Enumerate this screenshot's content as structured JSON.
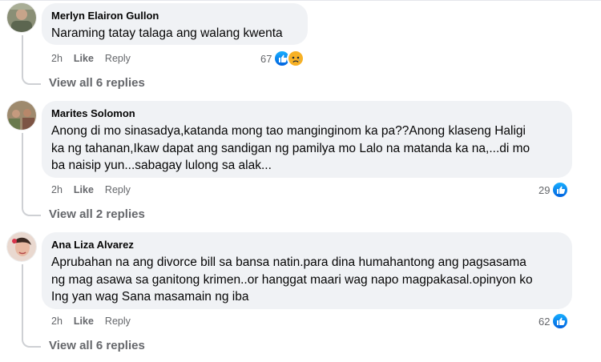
{
  "comments": [
    {
      "author": "Merlyn Elairon Gullon",
      "text": "Naraming tatay talaga ang walang kwenta",
      "time": "2h",
      "like_label": "Like",
      "reply_label": "Reply",
      "reaction_count": "67",
      "reactions": [
        "like-icon",
        "sad-icon"
      ],
      "view_replies": "View all 6 replies"
    },
    {
      "author": "Marites Solomon",
      "text_lines": [
        "Anong di mo sinasadya,katanda mong tao manginginom ka pa??Anong klaseng Haligi",
        "ka ng tahanan,Ikaw dapat ang sandigan ng pamilya mo Lalo na matanda ka na,...di mo",
        "ba naisip yun...sabagay lulong sa alak..."
      ],
      "time": "2h",
      "like_label": "Like",
      "reply_label": "Reply",
      "reaction_count": "29",
      "reactions": [
        "like-icon"
      ],
      "view_replies": "View all 2 replies"
    },
    {
      "author": "Ana Liza Alvarez",
      "text_lines": [
        "Aprubahan na ang divorce bill sa bansa natin.para dina humahantong ang pagsasama",
        "ng mag asawa sa ganitong krimen..or hanggat maari wag napo magpakasal.opinyon ko",
        "Ing yan wag Sana masamain ng iba"
      ],
      "time": "2h",
      "like_label": "Like",
      "reply_label": "Reply",
      "reaction_count": "62",
      "reactions": [
        "like-icon"
      ],
      "view_replies": "View all 6 replies"
    }
  ],
  "colors": {
    "bubble": "#f0f2f5",
    "secondary_text": "#65676b",
    "like_blue": "#0866ff",
    "sad_yellow": "#f7b125"
  }
}
